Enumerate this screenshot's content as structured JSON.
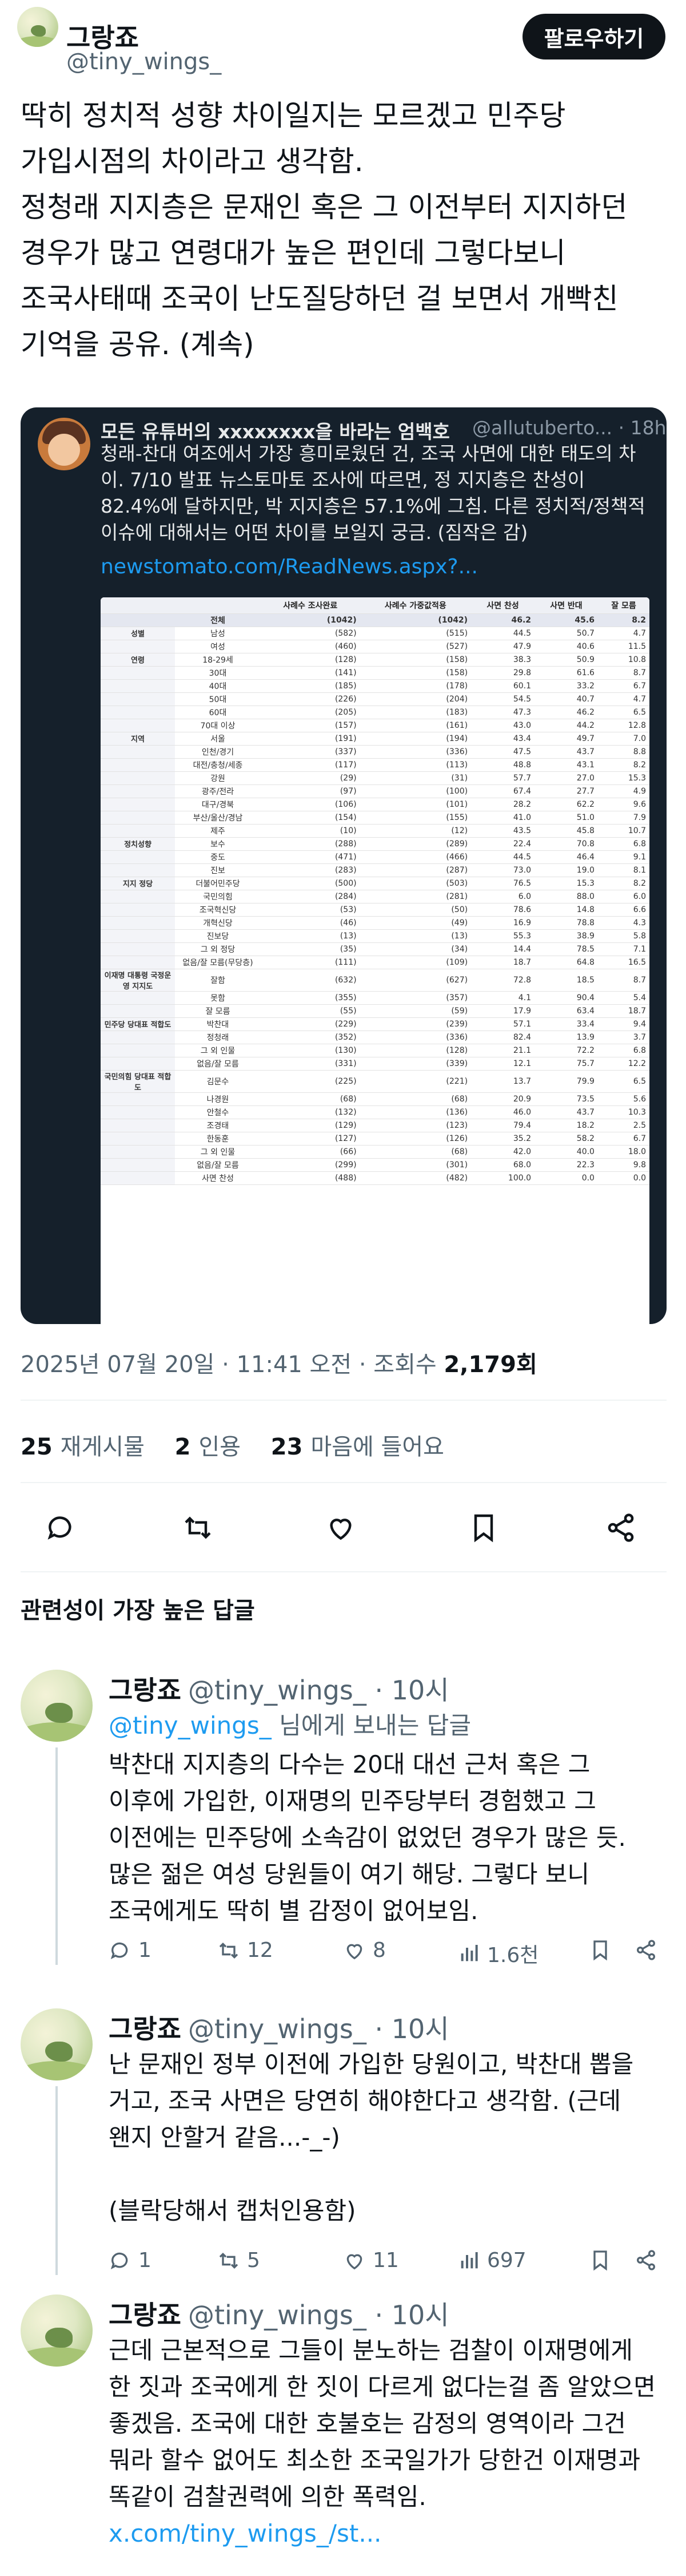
{
  "author": {
    "name": "그랑죠",
    "handle": "@tiny_wings_",
    "follow_label": "팔로우하기"
  },
  "tweet": {
    "lines": [
      "딱히 정치적 성향 차이일지는 모르겠고 민주당",
      "가입시점의 차이라고 생각함.",
      "정청래 지지층은 문재인 혹은 그 이전부터 지지하던",
      "경우가 많고 연령대가 높은 편인데 그렇다보니",
      "조국사태때 조국이 난도질당하던 걸 보면서 개빡친",
      "기억을 공유. (계속)"
    ],
    "timestamp": "2025년 07월 20일 · 11:41 오전 · 조회수 ",
    "views": "2,179회"
  },
  "quote": {
    "author_name": "모든 유튜버의 xxxxxxxx을 바라는 엄백호",
    "meta": "@allutuberto... · 18h",
    "text": "청래-찬대 여조에서 가장 흥미로웠던 건, 조국 사면에 대한 태도의 차이. 7/10 발표 뉴스토마토 조사에 따르면, 정 지지층은 찬성이 82.4%에 달하지만, 박 지지층은 57.1%에 그침. 다른 정치적/정책적 이슈에 대해서는 어떤 차이를 보일지 궁금. (짐작은 감)",
    "link": "newstomato.com/ReadNews.aspx?..."
  },
  "poll_table": {
    "headers": [
      "",
      "",
      "사례수 조사완료",
      "사례수 가중값적용",
      "사면 찬성",
      "사면 반대",
      "잘 모름"
    ],
    "rows": [
      [
        "",
        "전체",
        "(1042)",
        "(1042)",
        "46.2",
        "45.6",
        "8.2"
      ],
      [
        "성별",
        "남성",
        "(582)",
        "(515)",
        "44.5",
        "50.7",
        "4.7"
      ],
      [
        "",
        "여성",
        "(460)",
        "(527)",
        "47.9",
        "40.6",
        "11.5"
      ],
      [
        "연령",
        "18-29세",
        "(128)",
        "(158)",
        "38.3",
        "50.9",
        "10.8"
      ],
      [
        "",
        "30대",
        "(141)",
        "(158)",
        "29.8",
        "61.6",
        "8.7"
      ],
      [
        "",
        "40대",
        "(185)",
        "(178)",
        "60.1",
        "33.2",
        "6.7"
      ],
      [
        "",
        "50대",
        "(226)",
        "(204)",
        "54.5",
        "40.7",
        "4.7"
      ],
      [
        "",
        "60대",
        "(205)",
        "(183)",
        "47.3",
        "46.2",
        "6.5"
      ],
      [
        "",
        "70대 이상",
        "(157)",
        "(161)",
        "43.0",
        "44.2",
        "12.8"
      ],
      [
        "지역",
        "서울",
        "(191)",
        "(194)",
        "43.4",
        "49.7",
        "7.0"
      ],
      [
        "",
        "인천/경기",
        "(337)",
        "(336)",
        "47.5",
        "43.7",
        "8.8"
      ],
      [
        "",
        "대전/충청/세종",
        "(117)",
        "(113)",
        "48.8",
        "43.1",
        "8.2"
      ],
      [
        "",
        "강원",
        "(29)",
        "(31)",
        "57.7",
        "27.0",
        "15.3"
      ],
      [
        "",
        "광주/전라",
        "(97)",
        "(100)",
        "67.4",
        "27.7",
        "4.9"
      ],
      [
        "",
        "대구/경북",
        "(106)",
        "(101)",
        "28.2",
        "62.2",
        "9.6"
      ],
      [
        "",
        "부산/울산/경남",
        "(154)",
        "(155)",
        "41.0",
        "51.0",
        "7.9"
      ],
      [
        "",
        "제주",
        "(10)",
        "(12)",
        "43.5",
        "45.8",
        "10.7"
      ],
      [
        "정치성향",
        "보수",
        "(288)",
        "(289)",
        "22.4",
        "70.8",
        "6.8"
      ],
      [
        "",
        "중도",
        "(471)",
        "(466)",
        "44.5",
        "46.4",
        "9.1"
      ],
      [
        "",
        "진보",
        "(283)",
        "(287)",
        "73.0",
        "19.0",
        "8.1"
      ],
      [
        "지지 정당",
        "더불어민주당",
        "(500)",
        "(503)",
        "76.5",
        "15.3",
        "8.2"
      ],
      [
        "",
        "국민의힘",
        "(284)",
        "(281)",
        "6.0",
        "88.0",
        "6.0"
      ],
      [
        "",
        "조국혁신당",
        "(53)",
        "(50)",
        "78.6",
        "14.8",
        "6.6"
      ],
      [
        "",
        "개혁신당",
        "(46)",
        "(49)",
        "16.9",
        "78.8",
        "4.3"
      ],
      [
        "",
        "진보당",
        "(13)",
        "(13)",
        "55.3",
        "38.9",
        "5.8"
      ],
      [
        "",
        "그 외 정당",
        "(35)",
        "(34)",
        "14.4",
        "78.5",
        "7.1"
      ],
      [
        "",
        "없음/잘 모름(무당층)",
        "(111)",
        "(109)",
        "18.7",
        "64.8",
        "16.5"
      ],
      [
        "이재명 대통령 국정운영 지지도",
        "잘함",
        "(632)",
        "(627)",
        "72.8",
        "18.5",
        "8.7"
      ],
      [
        "",
        "못함",
        "(355)",
        "(357)",
        "4.1",
        "90.4",
        "5.4"
      ],
      [
        "",
        "잘 모름",
        "(55)",
        "(59)",
        "17.9",
        "63.4",
        "18.7"
      ],
      [
        "민주당 당대표 적합도",
        "박찬대",
        "(229)",
        "(239)",
        "57.1",
        "33.4",
        "9.4"
      ],
      [
        "",
        "정청래",
        "(352)",
        "(336)",
        "82.4",
        "13.9",
        "3.7"
      ],
      [
        "",
        "그 외 인물",
        "(130)",
        "(128)",
        "21.1",
        "72.2",
        "6.8"
      ],
      [
        "",
        "없음/잘 모름",
        "(331)",
        "(339)",
        "12.1",
        "75.7",
        "12.2"
      ],
      [
        "국민의힘 당대표 적합도",
        "김문수",
        "(225)",
        "(221)",
        "13.7",
        "79.9",
        "6.5"
      ],
      [
        "",
        "나경원",
        "(68)",
        "(68)",
        "20.9",
        "73.5",
        "5.6"
      ],
      [
        "",
        "안철수",
        "(132)",
        "(136)",
        "46.0",
        "43.7",
        "10.3"
      ],
      [
        "",
        "조경태",
        "(129)",
        "(123)",
        "79.4",
        "18.2",
        "2.5"
      ],
      [
        "",
        "한동훈",
        "(127)",
        "(126)",
        "35.2",
        "58.2",
        "6.7"
      ],
      [
        "",
        "그 외 인물",
        "(66)",
        "(68)",
        "42.0",
        "40.0",
        "18.0"
      ],
      [
        "",
        "없음/잘 모름",
        "(299)",
        "(301)",
        "68.0",
        "22.3",
        "9.8"
      ],
      [
        "",
        "사면 찬성",
        "(488)",
        "(482)",
        "100.0",
        "0.0",
        "0.0"
      ]
    ]
  },
  "stats": {
    "retweets_count": "25",
    "retweets_label": "재게시물",
    "quotes_count": "2",
    "quotes_label": "인용",
    "likes_count": "23",
    "likes_label": "마음에 들어요"
  },
  "section_title": "관련성이 가장 높은 답글",
  "replies": [
    {
      "name": "그랑죠",
      "handle": "@tiny_wings_ · 10시",
      "reply_to_mention": "@tiny_wings_",
      "reply_to_suffix": " 님에게 보내는 답글",
      "text": "박찬대 지지층의 다수는 20대 대선 근처 혹은 그\n이후에 가입한, 이재명의 민주당부터 경험했고 그\n이전에는 민주당에 소속감이 없었던 경우가 많은 듯.\n많은 젊은 여성 당원들이 여기 해당. 그렇다 보니\n조국에게도 딱히 별 감정이 없어보임.",
      "replies": "1",
      "retweets": "12",
      "likes": "8",
      "views": "1.6천"
    },
    {
      "name": "그랑죠",
      "handle": "@tiny_wings_ · 10시",
      "text": "난 문재인 정부 이전에 가입한 당원이고, 박찬대 뽑을\n거고, 조국 사면은 당연히 해야한다고 생각함. (근데\n왠지 안할거 같음...-_-)\n\n(블락당해서 캡처인용함)",
      "replies": "1",
      "retweets": "5",
      "likes": "11",
      "views": "697"
    },
    {
      "name": "그랑죠",
      "handle": "@tiny_wings_ · 10시",
      "text": "근데 근본적으로 그들이 분노하는 검찰이 이재명에게\n한 짓과 조국에게 한 짓이 다르게 없다는걸 좀 알았으면\n좋겠음. 조국에 대한 호불호는 감정의 영역이라 그건\n뭐라 할수 없어도 최소한 조국일가가 당한건 이재명과\n똑같이 검찰권력에 의한 폭력임.",
      "link": "x.com/tiny_wings_/st..."
    }
  ]
}
